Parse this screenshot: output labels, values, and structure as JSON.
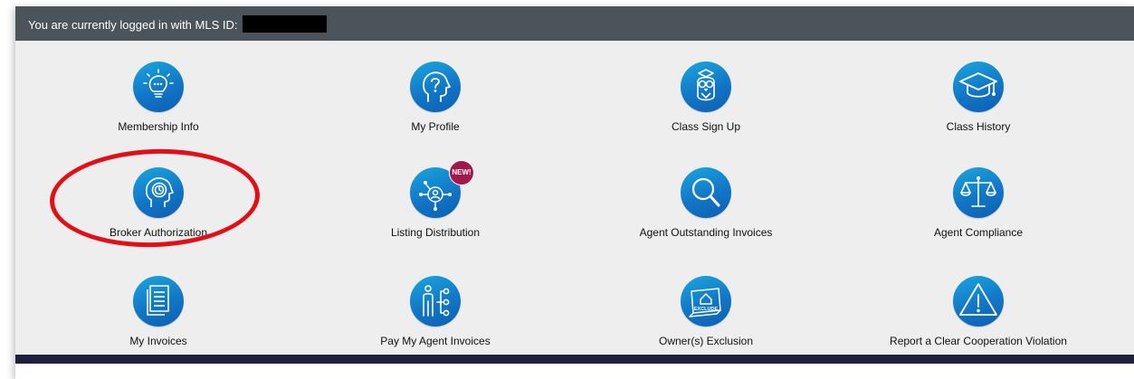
{
  "header": {
    "login_text": "You are currently logged in with MLS ID:"
  },
  "tiles": [
    {
      "label": "Membership Info",
      "icon": "lightbulb-icon"
    },
    {
      "label": "My Profile",
      "icon": "head-question-icon"
    },
    {
      "label": "Class Sign Up",
      "icon": "owl-icon"
    },
    {
      "label": "Class History",
      "icon": "graduation-cap-icon"
    },
    {
      "label": "Broker Authorization",
      "icon": "head-clock-icon"
    },
    {
      "label": "Listing Distribution",
      "icon": "network-people-icon",
      "badge": "NEW!"
    },
    {
      "label": "Agent Outstanding Invoices",
      "icon": "magnifier-icon"
    },
    {
      "label": "Agent Compliance",
      "icon": "scales-icon"
    },
    {
      "label": "My Invoices",
      "icon": "documents-icon"
    },
    {
      "label": "Pay My Agent Invoices",
      "icon": "person-flowchart-icon"
    },
    {
      "label": "Owner(s) Exclusion",
      "icon": "exclude-sign-icon",
      "icon_text": "EXCLUDE"
    },
    {
      "label": "Report a Clear Cooperation Violation",
      "icon": "warning-triangle-icon"
    }
  ],
  "colors": {
    "topbar": "#4b535b",
    "panel": "#eeeeee",
    "icon_gradient_start": "#1aa7df",
    "icon_gradient_end": "#0d5fb2",
    "badge": "#a3174d",
    "annotation_circle": "#e40e16",
    "bottom_bar": "#1f1f3e"
  }
}
